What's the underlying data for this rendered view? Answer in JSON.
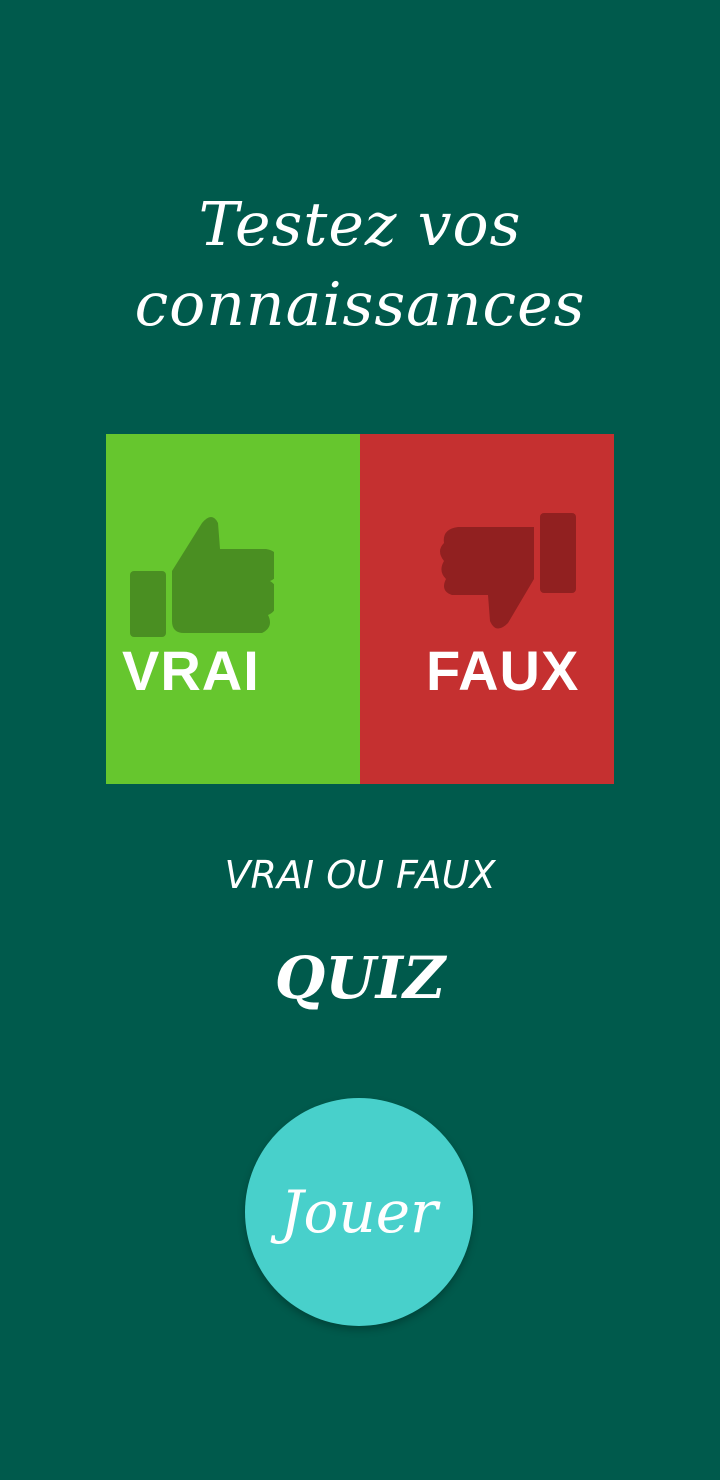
{
  "app": {
    "background_color": "#005a4c"
  },
  "headline": {
    "line1": "Testez vos",
    "line2": "connaissances"
  },
  "banner": {
    "true_label": "VRAI",
    "false_label": "FAUX",
    "true_color": "#66c62e",
    "false_color": "#c53030",
    "true_icon": "thumbs-up-icon",
    "false_icon": "thumbs-down-icon"
  },
  "subtitle": "VRAI OU FAUX",
  "quiz_title": "QUIZ",
  "play_button": {
    "label": "Jouer",
    "color": "#48d0cb"
  }
}
